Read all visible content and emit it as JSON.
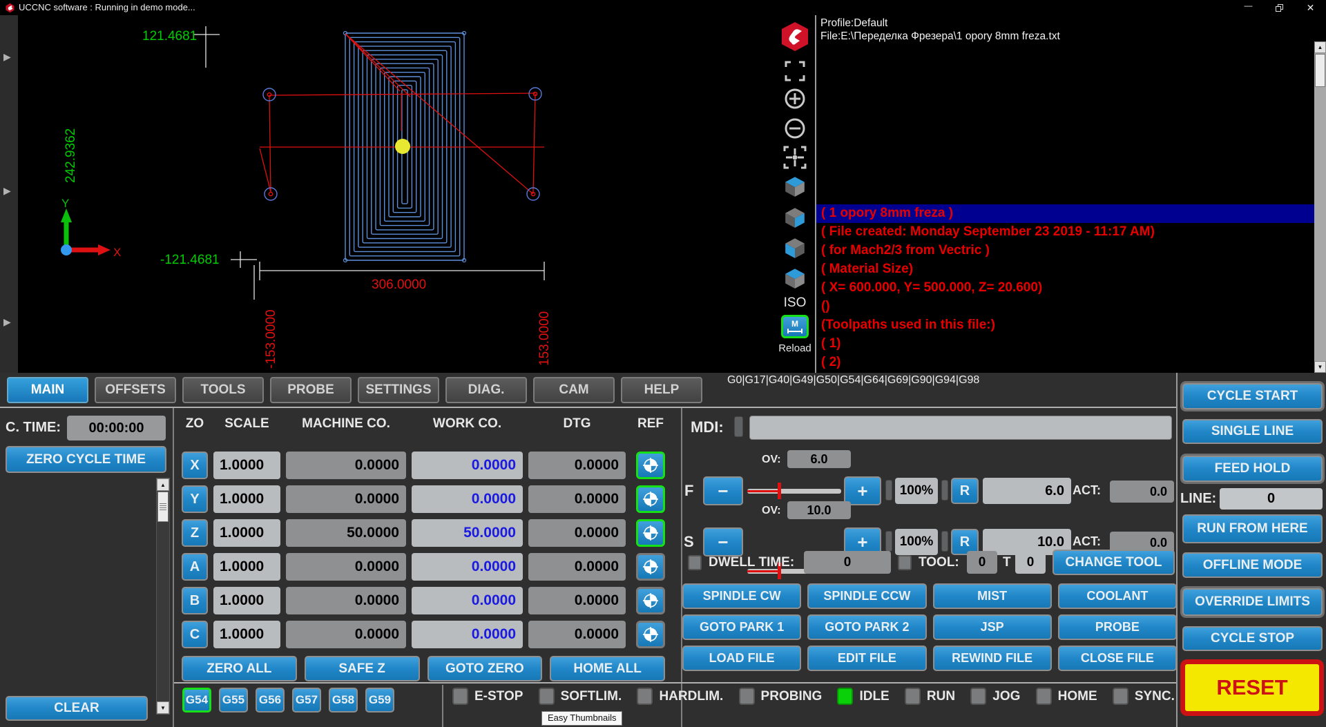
{
  "window": {
    "title": "UCCNC software : Running in demo mode...",
    "profile": "Profile:Default",
    "file": "File:E:\\Переделка Фрезера\\1 opory 8mm freza.txt"
  },
  "viewport": {
    "dimensions": {
      "height_top": "121.4681",
      "height_total": "242.9362",
      "height_bottom": "-121.4681",
      "width": "306.0000",
      "extent_left": "-153.0000",
      "extent_right": "153.0000"
    },
    "axis_labels": {
      "x": "X",
      "y": "Y"
    },
    "view_controls": {
      "iso": "ISO",
      "reload": "Reload",
      "units": "M"
    }
  },
  "file_panel": {
    "lines": [
      "( 1 opory 8mm freza )",
      "( File created: Monday September 23 2019 - 11:17 AM)",
      "( for Mach2/3 from Vectric )",
      "( Material Size)",
      "( X= 600.000, Y= 500.000, Z= 20.600)",
      "()",
      "(Toolpaths used in this file:)",
      "( 1)",
      "( 2)"
    ],
    "highlighted_line": 0
  },
  "tabs": [
    {
      "label": "MAIN",
      "active": true
    },
    {
      "label": "OFFSETS",
      "active": false
    },
    {
      "label": "TOOLS",
      "active": false
    },
    {
      "label": "PROBE",
      "active": false
    },
    {
      "label": "SETTINGS",
      "active": false
    },
    {
      "label": "DIAG.",
      "active": false
    },
    {
      "label": "CAM",
      "active": false
    },
    {
      "label": "HELP",
      "active": false
    }
  ],
  "gcode_modals": "G0|G17|G40|G49|G50|G54|G64|G69|G90|G94|G98",
  "left_panel": {
    "cycle_time_label": "C. TIME:",
    "cycle_time": "00:00:00",
    "zero_cycle_time": "ZERO CYCLE TIME",
    "clear": "CLEAR"
  },
  "axis_table": {
    "headers": {
      "zo": "ZO",
      "scale": "SCALE",
      "machine": "MACHINE CO.",
      "work": "WORK CO.",
      "dtg": "DTG",
      "ref": "REF"
    },
    "rows": [
      {
        "axis": "X",
        "scale": "1.0000",
        "machine": "0.0000",
        "work": "0.0000",
        "dtg": "0.0000",
        "referenced": true
      },
      {
        "axis": "Y",
        "scale": "1.0000",
        "machine": "0.0000",
        "work": "0.0000",
        "dtg": "0.0000",
        "referenced": true
      },
      {
        "axis": "Z",
        "scale": "1.0000",
        "machine": "50.0000",
        "work": "50.0000",
        "dtg": "0.0000",
        "referenced": true
      },
      {
        "axis": "A",
        "scale": "1.0000",
        "machine": "0.0000",
        "work": "0.0000",
        "dtg": "0.0000",
        "referenced": false
      },
      {
        "axis": "B",
        "scale": "1.0000",
        "machine": "0.0000",
        "work": "0.0000",
        "dtg": "0.0000",
        "referenced": false
      },
      {
        "axis": "C",
        "scale": "1.0000",
        "machine": "0.0000",
        "work": "0.0000",
        "dtg": "0.0000",
        "referenced": false
      }
    ],
    "buttons": [
      "ZERO ALL",
      "SAFE Z",
      "GOTO ZERO",
      "HOME ALL"
    ],
    "work_offsets": [
      {
        "label": "G54",
        "active": true
      },
      {
        "label": "G55",
        "active": false
      },
      {
        "label": "G56",
        "active": false
      },
      {
        "label": "G57",
        "active": false
      },
      {
        "label": "G58",
        "active": false
      },
      {
        "label": "G59",
        "active": false
      }
    ]
  },
  "mdi": {
    "label": "MDI:",
    "value": ""
  },
  "feed": {
    "axis_label": "F",
    "ov_label": "OV:",
    "ov_value": "6.0",
    "minus": "−",
    "plus": "+",
    "percent": "100%",
    "reset": "R",
    "value": "6.0",
    "act_label": "ACT:",
    "act_value": "0.0"
  },
  "spindle": {
    "axis_label": "S",
    "ov_label": "OV:",
    "ov_value": "10.0",
    "minus": "−",
    "plus": "+",
    "percent": "100%",
    "reset": "R",
    "value": "10.0",
    "act_label": "ACT:",
    "act_value": "0.0"
  },
  "tool_row": {
    "dwell_label": "DWELL TIME:",
    "dwell_value": "0",
    "tool_label": "TOOL:",
    "tool_value": "0",
    "t_label": "T",
    "t_value": "0",
    "change_tool": "CHANGE TOOL"
  },
  "actions": [
    "SPINDLE CW",
    "SPINDLE CCW",
    "MIST",
    "COOLANT",
    "GOTO PARK 1",
    "GOTO PARK 2",
    "JSP",
    "PROBE",
    "LOAD FILE",
    "EDIT FILE",
    "REWIND FILE",
    "CLOSE FILE"
  ],
  "right_panel": {
    "cycle_start": "CYCLE START",
    "single_line": "SINGLE LINE",
    "feed_hold": "FEED HOLD",
    "line_label": "LINE:",
    "line_value": "0",
    "run_from_here": "RUN FROM HERE",
    "offline_mode": "OFFLINE MODE",
    "override_limits": "OVERRIDE LIMITS",
    "cycle_stop": "CYCLE STOP",
    "reset": "RESET"
  },
  "status_leds": [
    {
      "label": "E-STOP",
      "on": false
    },
    {
      "label": "SOFTLIM.",
      "on": false
    },
    {
      "label": "HARDLIM.",
      "on": false
    },
    {
      "label": "PROBING",
      "on": false
    },
    {
      "label": "IDLE",
      "on": true
    },
    {
      "label": "RUN",
      "on": false
    },
    {
      "label": "JOG",
      "on": false
    },
    {
      "label": "HOME",
      "on": false
    },
    {
      "label": "SYNC.",
      "on": false
    }
  ],
  "tooltip": "Easy Thumbnails",
  "colors": {
    "accent_blue": "#1f82c4",
    "active_green": "#0ad00a",
    "alert_red": "#e01010",
    "reset_yellow": "#f5e800",
    "dim_green": "#00cc00",
    "highlight_blue": "#000090"
  }
}
